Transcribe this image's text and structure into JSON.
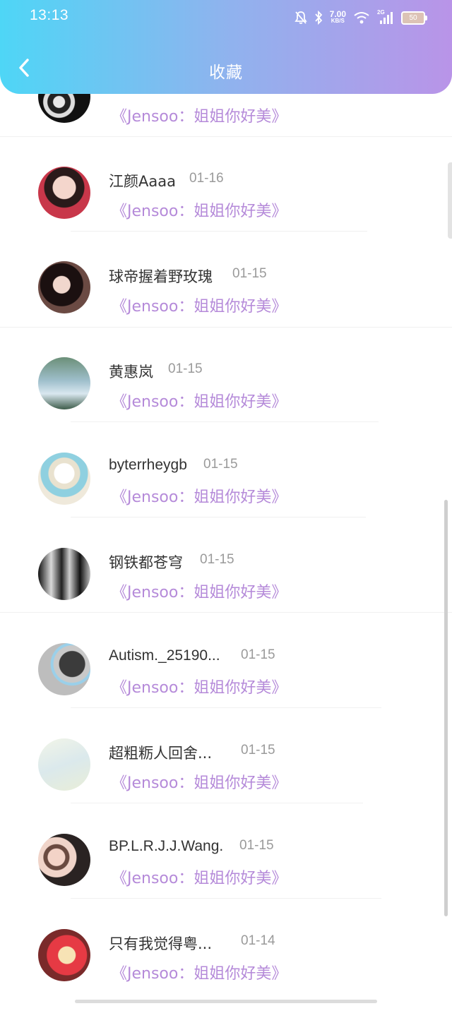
{
  "status_bar": {
    "time": "13:13",
    "speed_value": "7.00",
    "speed_unit": "KB/S",
    "network": "2G",
    "battery": "50"
  },
  "header": {
    "title": "收藏"
  },
  "items": [
    {
      "name": "",
      "date": "",
      "subtitle": "《Jensoo：姐姐你好美》"
    },
    {
      "name": "江颜Aaaa",
      "date": "01-16",
      "subtitle": "《Jensoo：姐姐你好美》"
    },
    {
      "name": "球帝握着野玫瑰",
      "date": "01-15",
      "subtitle": "《Jensoo：姐姐你好美》"
    },
    {
      "name": "黄惠岚",
      "date": "01-15",
      "subtitle": "《Jensoo：姐姐你好美》"
    },
    {
      "name": "byterrheygb",
      "date": "01-15",
      "subtitle": "《Jensoo：姐姐你好美》"
    },
    {
      "name": "钢铁都苍穹",
      "date": "01-15",
      "subtitle": "《Jensoo：姐姐你好美》"
    },
    {
      "name": "Autism._25190...",
      "date": "01-15",
      "subtitle": "《Jensoo：姐姐你好美》"
    },
    {
      "name": "超粗粝人回舍...",
      "date": "01-15",
      "subtitle": "《Jensoo：姐姐你好美》"
    },
    {
      "name": "BP.L.R.J.J.Wang.",
      "date": "01-15",
      "subtitle": "《Jensoo：姐姐你好美》"
    },
    {
      "name": "只有我觉得粤...",
      "date": "01-14",
      "subtitle": "《Jensoo：姐姐你好美》"
    }
  ]
}
